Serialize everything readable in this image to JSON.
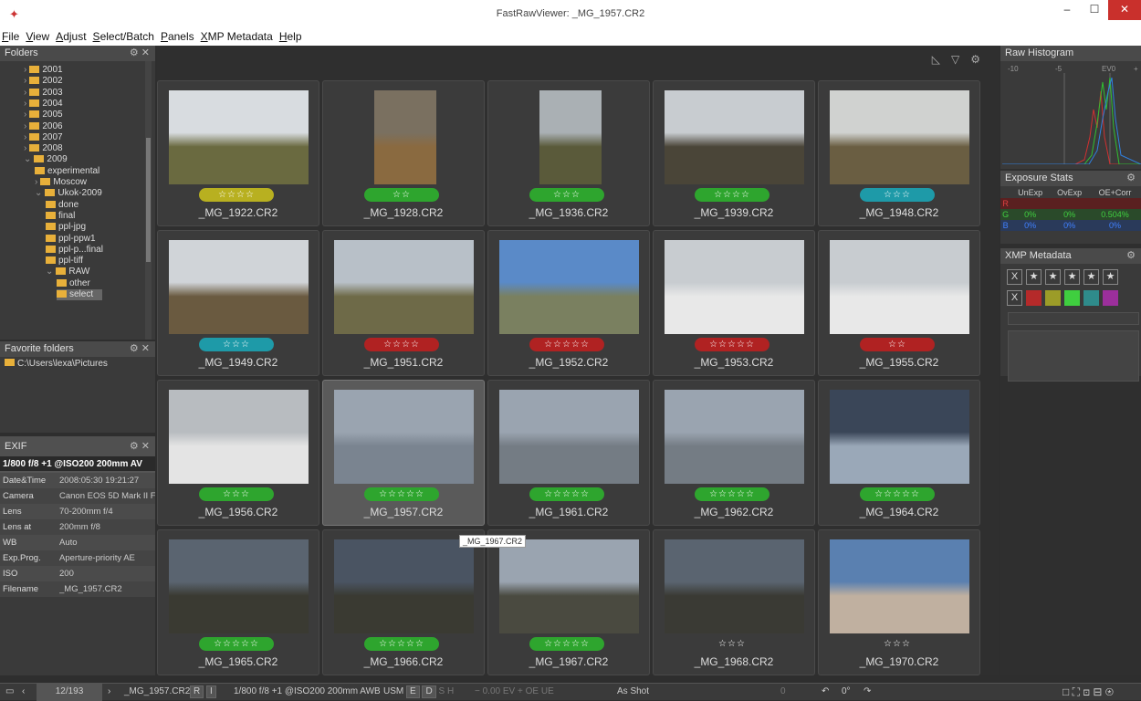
{
  "window": {
    "title": "FastRawViewer: _MG_1957.CR2"
  },
  "menu": [
    "File",
    "View",
    "Adjust",
    "Select/Batch",
    "Panels",
    "XMP Metadata",
    "Help"
  ],
  "folders": {
    "title": "Folders",
    "items": [
      {
        "label": "2001",
        "depth": 1,
        "arrow": "›"
      },
      {
        "label": "2002",
        "depth": 1,
        "arrow": "›"
      },
      {
        "label": "2003",
        "depth": 1,
        "arrow": "›"
      },
      {
        "label": "2004",
        "depth": 1,
        "arrow": "›"
      },
      {
        "label": "2005",
        "depth": 1,
        "arrow": "›"
      },
      {
        "label": "2006",
        "depth": 1,
        "arrow": "›"
      },
      {
        "label": "2007",
        "depth": 1,
        "arrow": "›"
      },
      {
        "label": "2008",
        "depth": 1,
        "arrow": "›"
      },
      {
        "label": "2009",
        "depth": 1,
        "arrow": "⌄"
      },
      {
        "label": "experimental",
        "depth": 2,
        "arrow": ""
      },
      {
        "label": "Moscow",
        "depth": 2,
        "arrow": "›"
      },
      {
        "label": "Ukok-2009",
        "depth": 2,
        "arrow": "⌄"
      },
      {
        "label": "done",
        "depth": 3,
        "arrow": ""
      },
      {
        "label": "final",
        "depth": 3,
        "arrow": ""
      },
      {
        "label": "ppl-jpg",
        "depth": 3,
        "arrow": ""
      },
      {
        "label": "ppl-ppw1",
        "depth": 3,
        "arrow": ""
      },
      {
        "label": "ppl-p...final",
        "depth": 3,
        "arrow": ""
      },
      {
        "label": "ppl-tiff",
        "depth": 3,
        "arrow": ""
      },
      {
        "label": "RAW",
        "depth": 3,
        "arrow": "⌄"
      },
      {
        "label": "other",
        "depth": 4,
        "arrow": ""
      },
      {
        "label": "select",
        "depth": 4,
        "arrow": "",
        "selected": true
      }
    ]
  },
  "favorites": {
    "title": "Favorite folders",
    "items": [
      "C:\\Users\\lexa\\Pictures"
    ]
  },
  "exif": {
    "title": "EXIF",
    "summary": "1/800 f/8 +1 @ISO200 200mm AV",
    "rows": [
      {
        "k": "Date&Time",
        "v": "2008:05:30 19:21:27"
      },
      {
        "k": "Camera",
        "v": "Canon EOS 5D Mark II F"
      },
      {
        "k": "Lens",
        "v": "70-200mm f/4"
      },
      {
        "k": "Lens at",
        "v": "200mm f/8"
      },
      {
        "k": "WB",
        "v": "Auto"
      },
      {
        "k": "Exp.Prog.",
        "v": "Aperture-priority AE"
      },
      {
        "k": "ISO",
        "v": "200"
      },
      {
        "k": "Filename",
        "v": "_MG_1957.CR2"
      }
    ]
  },
  "thumbnails": [
    {
      "name": "_MG_1922.CR2",
      "stars": "☆☆☆☆",
      "color": "#b8b020",
      "sky": "#d8dce0",
      "land": "#6a6a40"
    },
    {
      "name": "_MG_1928.CR2",
      "stars": "☆☆",
      "color": "#2ea52e",
      "sky": "#7a7060",
      "land": "#8a6a40",
      "portrait": true
    },
    {
      "name": "_MG_1936.CR2",
      "stars": "☆☆☆",
      "color": "#2ea52e",
      "sky": "#aab0b4",
      "land": "#5a5a3a",
      "portrait": true
    },
    {
      "name": "_MG_1939.CR2",
      "stars": "☆☆☆☆",
      "color": "#2ea52e",
      "sky": "#c8ccd0",
      "land": "#4a4538"
    },
    {
      "name": "_MG_1948.CR2",
      "stars": "☆☆☆",
      "color": "#1e9aa8",
      "sky": "#d0d2d0",
      "land": "#6a5e42"
    },
    {
      "name": "_MG_1949.CR2",
      "stars": "☆☆☆",
      "color": "#1e9aa8",
      "sky": "#d0d4d8",
      "land": "#6a5a40"
    },
    {
      "name": "_MG_1951.CR2",
      "stars": "☆☆☆☆",
      "color": "#b02222",
      "sky": "#b8c0c8",
      "land": "#6e6a48"
    },
    {
      "name": "_MG_1952.CR2",
      "stars": "☆☆☆☆☆",
      "color": "#b02222",
      "sky": "#5a8ac8",
      "land": "#7a8060"
    },
    {
      "name": "_MG_1953.CR2",
      "stars": "☆☆☆☆☆",
      "color": "#b02222",
      "sky": "#c8ccd0",
      "land": "#e8e8e8"
    },
    {
      "name": "_MG_1955.CR2",
      "stars": "☆☆",
      "color": "#b02222",
      "sky": "#c8ccd0",
      "land": "#e8e8e8"
    },
    {
      "name": "_MG_1956.CR2",
      "stars": "☆☆☆",
      "color": "#2ea52e",
      "sky": "#b8bcc0",
      "land": "#e4e4e4"
    },
    {
      "name": "_MG_1957.CR2",
      "stars": "☆☆☆☆☆",
      "color": "#2ea52e",
      "sky": "#9aa4b0",
      "land": "#7a8490",
      "selected": true
    },
    {
      "name": "_MG_1961.CR2",
      "stars": "☆☆☆☆☆",
      "color": "#2ea52e",
      "sky": "#9aa4b0",
      "land": "#747c84"
    },
    {
      "name": "_MG_1962.CR2",
      "stars": "☆☆☆☆☆",
      "color": "#2ea52e",
      "sky": "#9aa4b0",
      "land": "#747c84"
    },
    {
      "name": "_MG_1964.CR2",
      "stars": "☆☆☆☆☆",
      "color": "#2ea52e",
      "sky": "#3a4658",
      "land": "#9aa8b8"
    },
    {
      "name": "_MG_1965.CR2",
      "stars": "☆☆☆☆☆",
      "color": "#2ea52e",
      "sky": "#5a6470",
      "land": "#3a3a32"
    },
    {
      "name": "_MG_1966.CR2",
      "stars": "☆☆☆☆☆",
      "color": "#2ea52e",
      "sky": "#4a5462",
      "land": "#3a3a32"
    },
    {
      "name": "_MG_1967.CR2",
      "stars": "☆☆☆☆☆",
      "color": "#2ea52e",
      "sky": "#9aa4b0",
      "land": "#4a4a40"
    },
    {
      "name": "_MG_1968.CR2",
      "stars": "☆☆☆",
      "color": "",
      "sky": "#5a6470",
      "land": "#3a3a34"
    },
    {
      "name": "_MG_1970.CR2",
      "stars": "☆☆☆",
      "color": "",
      "sky": "#5a80b0",
      "land": "#c0b0a0"
    }
  ],
  "tooltip": "_MG_1967.CR2",
  "histogram": {
    "title": "Raw Histogram",
    "ticks": [
      "-10",
      "-5",
      "EV0",
      "+"
    ]
  },
  "exposure": {
    "title": "Exposure Stats",
    "headers": [
      "",
      "UnExp",
      "OvExp",
      "OE+Corr"
    ],
    "rows": [
      {
        "ch": "R",
        "vals": [
          "",
          "",
          ""
        ]
      },
      {
        "ch": "G",
        "vals": [
          "0%",
          "0%",
          "0.504%"
        ]
      },
      {
        "ch": "B",
        "vals": [
          "0%",
          "0%",
          "0%"
        ]
      }
    ]
  },
  "xmp": {
    "title": "XMP Metadata",
    "x_label": "X",
    "star": "★",
    "colors": [
      "#b52a2a",
      "#9c9c28",
      "#3fce3f",
      "#2f8b8b",
      "#9c2f9c"
    ]
  },
  "status": {
    "counter": "12/193",
    "filename": "_MG_1957.CR2",
    "r": "R",
    "i": "I",
    "exif": "1/800 f/8 +1 @ISO200 200mm AWB",
    "usm": "USM",
    "e": "E",
    "d": "D",
    "s": "S",
    "h": "H",
    "ev": "0.00 EV",
    "oe": "OE",
    "ue": "UE",
    "wb": "As Shot",
    "rot": "0°",
    "zero": "0"
  },
  "colors": {
    "title_bg": "#ffffff",
    "panel_bg": "#3a3a3a",
    "accent_green": "#2ea52e",
    "accent_red": "#b02222",
    "accent_teal": "#1e9aa8"
  }
}
